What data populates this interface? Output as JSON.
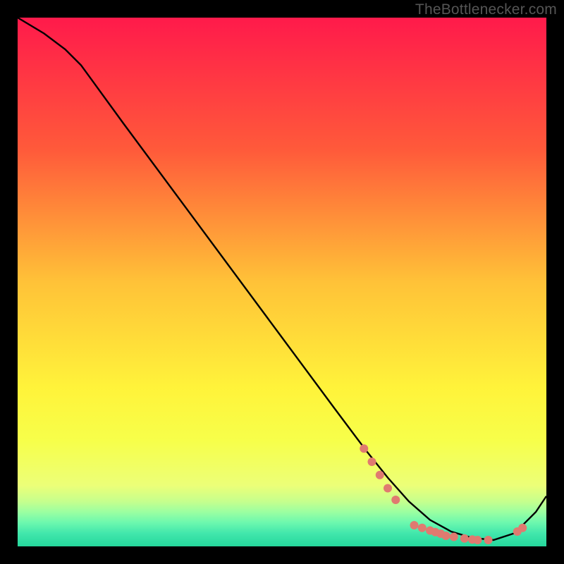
{
  "watermark": "TheBottlenecker.com",
  "chart_data": {
    "type": "line",
    "title": "",
    "xlabel": "",
    "ylabel": "",
    "xlim": [
      0,
      100
    ],
    "ylim": [
      0,
      100
    ],
    "background_gradient": {
      "type": "linear-vertical",
      "stops": [
        {
          "pos": 0.0,
          "color": "#ff1a4b"
        },
        {
          "pos": 0.25,
          "color": "#ff5a3a"
        },
        {
          "pos": 0.5,
          "color": "#ffc238"
        },
        {
          "pos": 0.7,
          "color": "#fff33a"
        },
        {
          "pos": 0.8,
          "color": "#f7ff4a"
        },
        {
          "pos": 0.885,
          "color": "#ecff78"
        },
        {
          "pos": 0.915,
          "color": "#c6ff8d"
        },
        {
          "pos": 0.935,
          "color": "#9bffa1"
        },
        {
          "pos": 0.955,
          "color": "#6cf8ae"
        },
        {
          "pos": 0.975,
          "color": "#42e7ac"
        },
        {
          "pos": 1.0,
          "color": "#25d79c"
        }
      ]
    },
    "series": [
      {
        "name": "bottleneck-curve",
        "color": "#000000",
        "x": [
          0,
          5,
          9,
          12,
          20,
          30,
          40,
          50,
          60,
          66,
          70,
          74,
          78,
          82,
          86,
          90,
          94,
          98,
          100
        ],
        "y": [
          100,
          97,
          94,
          91,
          80,
          66.5,
          53,
          39.5,
          26,
          18,
          13,
          8.5,
          5,
          2.8,
          1.6,
          1.2,
          2.5,
          6.5,
          9.5
        ]
      }
    ],
    "markers": {
      "name": "highlight-points",
      "color": "#e07a70",
      "radius": 6,
      "points": [
        {
          "x": 65.5,
          "y": 18.5
        },
        {
          "x": 67.0,
          "y": 16.0
        },
        {
          "x": 68.5,
          "y": 13.5
        },
        {
          "x": 70.0,
          "y": 11.0
        },
        {
          "x": 71.5,
          "y": 8.8
        },
        {
          "x": 75.0,
          "y": 4.0
        },
        {
          "x": 76.5,
          "y": 3.5
        },
        {
          "x": 78.0,
          "y": 3.0
        },
        {
          "x": 79.0,
          "y": 2.7
        },
        {
          "x": 80.0,
          "y": 2.4
        },
        {
          "x": 81.0,
          "y": 2.0
        },
        {
          "x": 82.5,
          "y": 1.8
        },
        {
          "x": 84.5,
          "y": 1.5
        },
        {
          "x": 86.0,
          "y": 1.3
        },
        {
          "x": 87.0,
          "y": 1.2
        },
        {
          "x": 89.0,
          "y": 1.2
        },
        {
          "x": 94.5,
          "y": 2.8
        },
        {
          "x": 95.5,
          "y": 3.5
        }
      ]
    }
  }
}
